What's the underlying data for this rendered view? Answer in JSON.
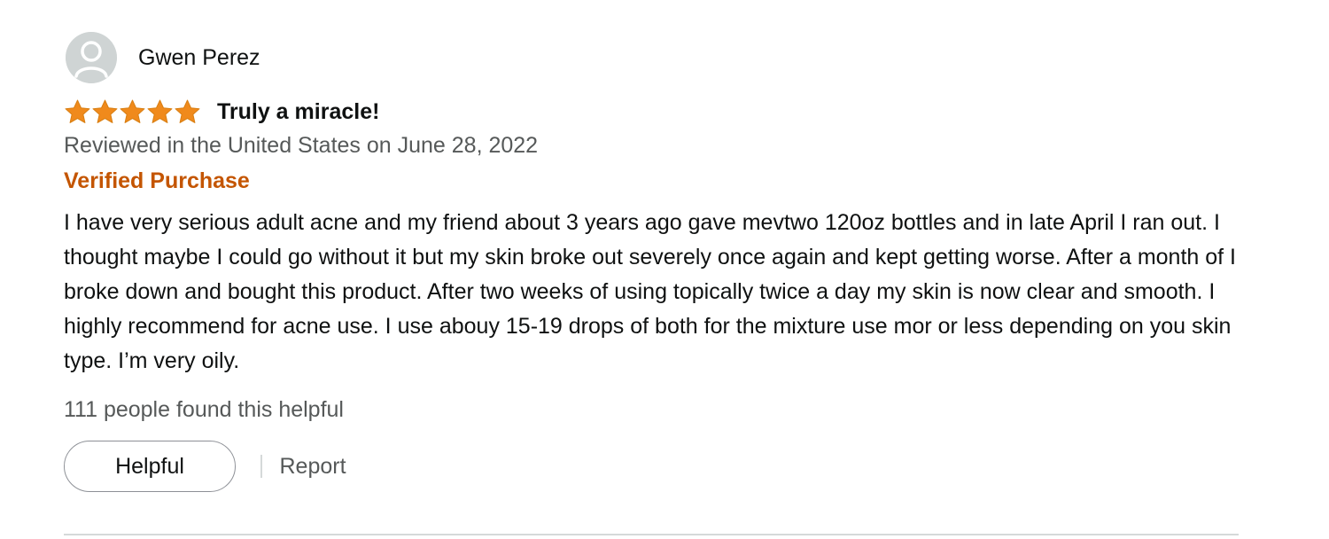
{
  "reviewer": {
    "name": "Gwen Perez",
    "avatar_icon": "default-user-icon"
  },
  "review": {
    "rating": 5,
    "rating_max": 5,
    "star_color": "#f08a1c",
    "title": "Truly a miracle!",
    "date_line": "Reviewed in the United States on June 28, 2022",
    "verified_label": "Verified Purchase",
    "verified_color": "#c45500",
    "body": "I have very serious adult acne and my friend about 3 years ago gave mevtwo 120oz bottles and in late April I ran out. I thought maybe I could go without it but my skin broke out severely once again and kept getting worse. After a month of I broke down and bought this product. After two weeks of using topically twice a day my skin is now clear and smooth. I highly recommend for acne use. I use abouy 15-19 drops of both for the mixture use mor or less depending on you skin type. I’m very oily.",
    "helpful_count_text": "111 people found this helpful"
  },
  "actions": {
    "helpful_label": "Helpful",
    "report_label": "Report"
  }
}
